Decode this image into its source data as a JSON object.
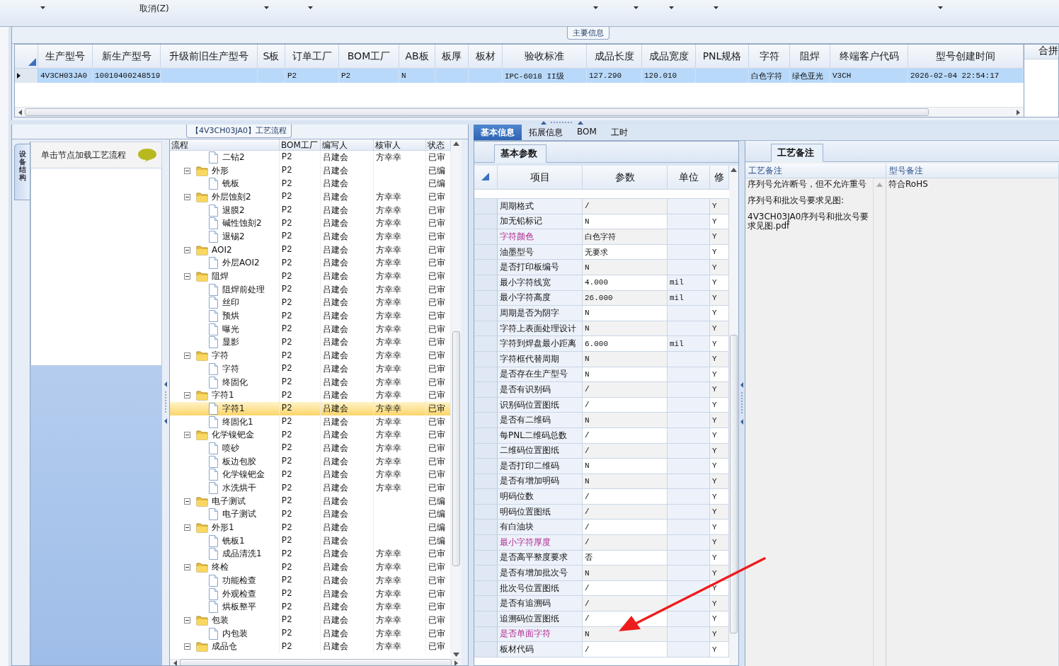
{
  "ribbon": {
    "button_label": "取消(Z)"
  },
  "main_info": {
    "title": "主要信息",
    "columns": [
      "生产型号",
      "新生产型号",
      "升级前旧生产型号",
      "S板",
      "订单工厂",
      "BOM工厂",
      "AB板",
      "板厚",
      "板材",
      "验收标准",
      "成品长度",
      "成品宽度",
      "PNL规格",
      "字符",
      "阻焊",
      "终端客户代码",
      "型号创建时间"
    ],
    "rows": [
      {
        "selected": true,
        "cells": [
          "4V3CH03JA0",
          "10010400248519",
          null,
          null,
          "P2",
          "P2",
          "N",
          null,
          null,
          "IPC-6018 II级",
          "127.290",
          "120.010",
          null,
          "白色字符",
          "绿色亚光",
          "V3CH",
          "2026-02-04 22:54:17"
        ]
      }
    ],
    "side_column": "合拼"
  },
  "process_panel": {
    "title": "【4V3CH03JA0】工艺流程",
    "side_tab": "设备结构",
    "hint": "单击节点加载工艺流程",
    "columns": [
      "流程",
      "BOM工厂",
      "编写人",
      "核审人",
      "状态"
    ],
    "tree": [
      {
        "children": [
          {
            "kind": "file",
            "label": "二钻2",
            "bom": "P2",
            "writer": "吕建会",
            "reviewer": "方幸幸",
            "status": "已审",
            "selected": false
          }
        ]
      },
      {
        "kind": "folder",
        "label": "外形",
        "bom": "P2",
        "writer": "吕建会",
        "status": "已编",
        "selected": false,
        "expanded": true,
        "children": [
          {
            "kind": "file",
            "label": "铣板",
            "bom": "P2",
            "writer": "吕建会",
            "status": "已编",
            "selected": false
          }
        ]
      },
      {
        "kind": "folder",
        "label": "外层蚀刻2",
        "bom": "P2",
        "writer": "吕建会",
        "reviewer": "方幸幸",
        "status": "已审",
        "selected": false,
        "expanded": true,
        "children": [
          {
            "kind": "file",
            "label": "退膜2",
            "bom": "P2",
            "writer": "吕建会",
            "reviewer": "方幸幸",
            "status": "已审",
            "selected": false
          },
          {
            "kind": "file",
            "label": "碱性蚀刻2",
            "bom": "P2",
            "writer": "吕建会",
            "reviewer": "方幸幸",
            "status": "已审",
            "selected": false
          },
          {
            "kind": "file",
            "label": "退锡2",
            "bom": "P2",
            "writer": "吕建会",
            "reviewer": "方幸幸",
            "status": "已审",
            "selected": false
          }
        ]
      },
      {
        "kind": "folder",
        "label": "AOI2",
        "bom": "P2",
        "writer": "吕建会",
        "reviewer": "方幸幸",
        "status": "已审",
        "selected": false,
        "expanded": true,
        "children": [
          {
            "kind": "file",
            "label": "外层AOI2",
            "bom": "P2",
            "writer": "吕建会",
            "reviewer": "方幸幸",
            "status": "已审",
            "selected": false
          }
        ]
      },
      {
        "kind": "folder",
        "label": "阻焊",
        "bom": "P2",
        "writer": "吕建会",
        "reviewer": "方幸幸",
        "status": "已审",
        "selected": false,
        "expanded": true,
        "children": [
          {
            "kind": "file",
            "label": "阻焊前处理",
            "bom": "P2",
            "writer": "吕建会",
            "reviewer": "方幸幸",
            "status": "已审",
            "selected": false
          },
          {
            "kind": "file",
            "label": "丝印",
            "bom": "P2",
            "writer": "吕建会",
            "reviewer": "方幸幸",
            "status": "已审",
            "selected": false
          },
          {
            "kind": "file",
            "label": "预烘",
            "bom": "P2",
            "writer": "吕建会",
            "reviewer": "方幸幸",
            "status": "已审",
            "selected": false
          },
          {
            "kind": "file",
            "label": "曝光",
            "bom": "P2",
            "writer": "吕建会",
            "reviewer": "方幸幸",
            "status": "已审",
            "selected": false
          },
          {
            "kind": "file",
            "label": "显影",
            "bom": "P2",
            "writer": "吕建会",
            "reviewer": "方幸幸",
            "status": "已审",
            "selected": false
          }
        ]
      },
      {
        "kind": "folder",
        "label": "字符",
        "bom": "P2",
        "writer": "吕建会",
        "reviewer": "方幸幸",
        "status": "已审",
        "selected": false,
        "expanded": true,
        "children": [
          {
            "kind": "file",
            "label": "字符",
            "bom": "P2",
            "writer": "吕建会",
            "reviewer": "方幸幸",
            "status": "已审",
            "selected": false
          },
          {
            "kind": "file",
            "label": "终固化",
            "bom": "P2",
            "writer": "吕建会",
            "reviewer": "方幸幸",
            "status": "已审",
            "selected": false
          }
        ]
      },
      {
        "kind": "folder",
        "label": "字符1",
        "bom": "P2",
        "writer": "吕建会",
        "reviewer": "方幸幸",
        "status": "已审",
        "selected": false,
        "expanded": true,
        "children": [
          {
            "kind": "file",
            "label": "字符1",
            "bom": "P2",
            "writer": "吕建会",
            "reviewer": "方幸幸",
            "status": "已审",
            "selected": true
          },
          {
            "kind": "file",
            "label": "终固化1",
            "bom": "P2",
            "writer": "吕建会",
            "reviewer": "方幸幸",
            "status": "已审",
            "selected": false
          }
        ]
      },
      {
        "kind": "folder",
        "label": "化学镍钯金",
        "bom": "P2",
        "writer": "吕建会",
        "reviewer": "方幸幸",
        "status": "已审",
        "selected": false,
        "expanded": true,
        "children": [
          {
            "kind": "file",
            "label": "喷砂",
            "bom": "P2",
            "writer": "吕建会",
            "reviewer": "方幸幸",
            "status": "已审",
            "selected": false
          },
          {
            "kind": "file",
            "label": "板边包胶",
            "bom": "P2",
            "writer": "吕建会",
            "reviewer": "方幸幸",
            "status": "已审",
            "selected": false
          },
          {
            "kind": "file",
            "label": "化学镍钯金",
            "bom": "P2",
            "writer": "吕建会",
            "reviewer": "方幸幸",
            "status": "已审",
            "selected": false
          },
          {
            "kind": "file",
            "label": "水洗烘干",
            "bom": "P2",
            "writer": "吕建会",
            "reviewer": "方幸幸",
            "status": "已审",
            "selected": false
          }
        ]
      },
      {
        "kind": "folder",
        "label": "电子测试",
        "bom": "P2",
        "writer": "吕建会",
        "status": "已编",
        "selected": false,
        "expanded": true,
        "children": [
          {
            "kind": "file",
            "label": "电子测试",
            "bom": "P2",
            "writer": "吕建会",
            "status": "已编",
            "selected": false
          }
        ]
      },
      {
        "kind": "folder",
        "label": "外形1",
        "bom": "P2",
        "writer": "吕建会",
        "status": "已编",
        "selected": false,
        "expanded": true,
        "children": [
          {
            "kind": "file",
            "label": "铣板1",
            "bom": "P2",
            "writer": "吕建会",
            "status": "已编",
            "selected": false
          },
          {
            "kind": "file",
            "label": "成品清洗1",
            "bom": "P2",
            "writer": "吕建会",
            "reviewer": "方幸幸",
            "status": "已审",
            "selected": false
          }
        ]
      },
      {
        "kind": "folder",
        "label": "终检",
        "bom": "P2",
        "writer": "吕建会",
        "reviewer": "方幸幸",
        "status": "已审",
        "selected": false,
        "expanded": true,
        "children": [
          {
            "kind": "file",
            "label": "功能检查",
            "bom": "P2",
            "writer": "吕建会",
            "reviewer": "方幸幸",
            "status": "已审",
            "selected": false
          },
          {
            "kind": "file",
            "label": "外观检查",
            "bom": "P2",
            "writer": "吕建会",
            "reviewer": "方幸幸",
            "status": "已审",
            "selected": false
          },
          {
            "kind": "file",
            "label": "烘板整平",
            "bom": "P2",
            "writer": "吕建会",
            "reviewer": "方幸幸",
            "status": "已审",
            "selected": false
          }
        ]
      },
      {
        "kind": "folder",
        "label": "包装",
        "bom": "P2",
        "writer": "吕建会",
        "reviewer": "方幸幸",
        "status": "已审",
        "selected": false,
        "expanded": true,
        "children": [
          {
            "kind": "file",
            "label": "内包装",
            "bom": "P2",
            "writer": "吕建会",
            "reviewer": "方幸幸",
            "status": "已审",
            "selected": false
          }
        ]
      },
      {
        "kind": "folder",
        "label": "成品仓",
        "bom": "P2",
        "writer": "吕建会",
        "reviewer": "方幸幸",
        "status": "已审",
        "selected": false,
        "expanded": true
      }
    ]
  },
  "detail_tabs": [
    {
      "label": "基本信息",
      "selected": true
    },
    {
      "label": "拓展信息",
      "selected": false
    },
    {
      "label": "BOM",
      "selected": false
    },
    {
      "label": "工时",
      "selected": false
    }
  ],
  "params_panel": {
    "subtab": {
      "label": "基本参数",
      "selected": true
    },
    "columns": [
      "项目",
      "参数",
      "单位",
      "修"
    ],
    "rows": [
      {
        "item": "周期格式",
        "value": "/",
        "flag": "Y",
        "highlight": false
      },
      {
        "item": "加无铅标记",
        "value": "N",
        "flag": "Y",
        "highlight": false
      },
      {
        "item": "字符颜色",
        "value": "白色字符",
        "flag": "Y",
        "highlight": true
      },
      {
        "item": "油墨型号",
        "value": "无要求",
        "flag": "Y",
        "highlight": false
      },
      {
        "item": "是否打印板编号",
        "value": "N",
        "flag": "Y",
        "highlight": false
      },
      {
        "item": "最小字符线宽",
        "value": "4.000",
        "unit": "mil",
        "flag": "Y",
        "highlight": false
      },
      {
        "item": "最小字符高度",
        "value": "26.000",
        "unit": "mil",
        "flag": "Y",
        "highlight": false
      },
      {
        "item": "周期是否为阴字",
        "value": "N",
        "flag": "Y",
        "highlight": false
      },
      {
        "item": "字符上表面处理设计",
        "value": "N",
        "flag": "Y",
        "highlight": false
      },
      {
        "item": "字符到焊盘最小距离",
        "value": "6.000",
        "unit": "mil",
        "flag": "Y",
        "highlight": false
      },
      {
        "item": "字符框代替周期",
        "value": "N",
        "flag": "Y",
        "highlight": false
      },
      {
        "item": "是否存在生产型号",
        "value": "N",
        "flag": "Y",
        "highlight": false
      },
      {
        "item": "是否有识别码",
        "value": "/",
        "flag": "Y",
        "highlight": false
      },
      {
        "item": "识别码位置图纸",
        "value": "/",
        "flag": "Y",
        "highlight": false
      },
      {
        "item": "是否有二维码",
        "value": "N",
        "flag": "Y",
        "highlight": false
      },
      {
        "item": "每PNL二维码总数",
        "value": "/",
        "flag": "Y",
        "highlight": false
      },
      {
        "item": "二维码位置图纸",
        "value": "/",
        "flag": "Y",
        "highlight": false
      },
      {
        "item": "是否打印二维码",
        "value": "N",
        "flag": "Y",
        "highlight": false
      },
      {
        "item": "是否有增加明码",
        "value": "N",
        "flag": "Y",
        "highlight": false
      },
      {
        "item": "明码位数",
        "value": "/",
        "flag": "Y",
        "highlight": false
      },
      {
        "item": "明码位置图纸",
        "value": "/",
        "flag": "Y",
        "highlight": false
      },
      {
        "item": "有白油块",
        "value": "/",
        "flag": "Y",
        "highlight": false
      },
      {
        "item": "最小字符厚度",
        "value": "/",
        "flag": "Y",
        "highlight": true
      },
      {
        "item": "是否高平整度要求",
        "value": "否",
        "flag": "Y",
        "highlight": false
      },
      {
        "item": "是否有增加批次号",
        "value": "N",
        "flag": "Y",
        "highlight": false
      },
      {
        "item": "批次号位置图纸",
        "value": "/",
        "flag": "Y",
        "highlight": false
      },
      {
        "item": "是否有追溯码",
        "value": "/",
        "flag": "Y",
        "highlight": false
      },
      {
        "item": "追溯码位置图纸",
        "value": "/",
        "flag": "Y",
        "highlight": false
      },
      {
        "item": "是否单面字符",
        "value": "N",
        "flag": "Y",
        "highlight": true
      },
      {
        "item": "板材代码",
        "value": "/",
        "flag": "Y",
        "highlight": false
      }
    ]
  },
  "notes_panel": {
    "tab": {
      "label": "工艺备注",
      "selected": true
    },
    "columns": [
      "工艺备注",
      "型号备注"
    ],
    "process_notes": [
      "序列号允许断号，但不允许重号",
      "序列号和批次号要求见图:",
      "4V3CH03JA0序列号和批次号要求见图.pdf"
    ],
    "model_notes": [
      "符合RoHS"
    ]
  },
  "annotations": [
    {
      "kind": "arrow"
    }
  ]
}
